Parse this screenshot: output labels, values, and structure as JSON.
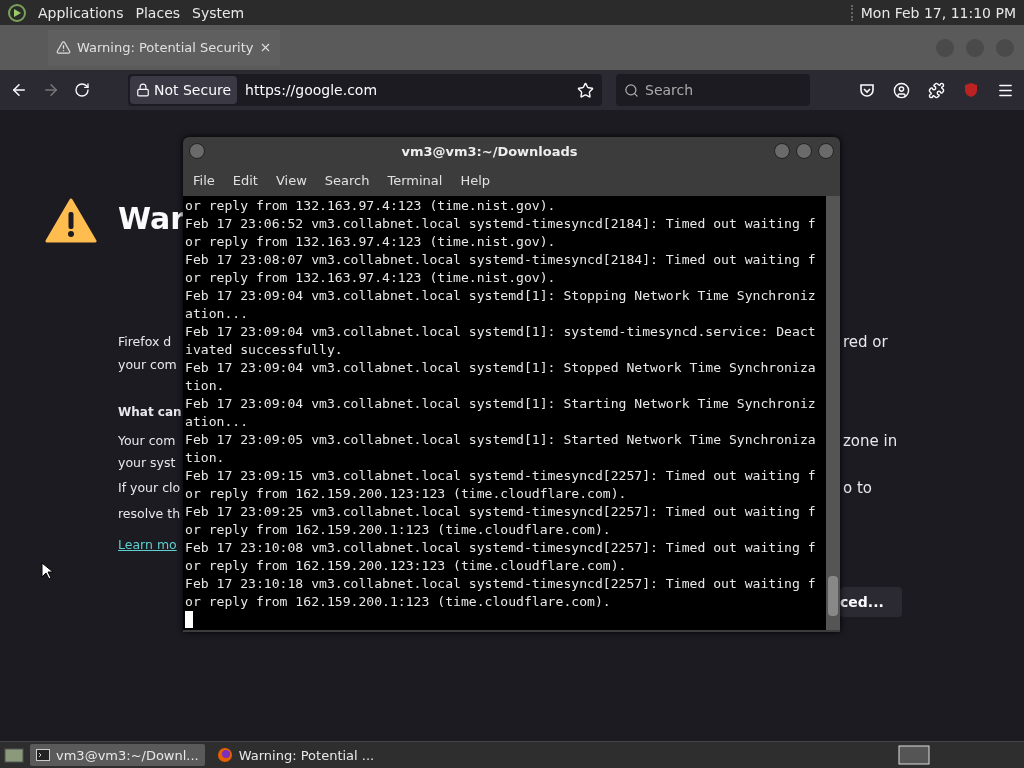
{
  "top_panel": {
    "menus": [
      "Applications",
      "Places",
      "System"
    ],
    "clock": "Mon Feb 17, 11:10 PM"
  },
  "browser": {
    "tabs": [
      {
        "title": "Warning: Potential Security",
        "selected": true
      }
    ],
    "url_bar": {
      "security_label": "Not Secure",
      "url": "https://google.com"
    },
    "search": {
      "placeholder": "Search"
    },
    "page": {
      "heading": "War",
      "rows": [
        {
          "kind": "text",
          "left": "Firefox d",
          "right": "red or"
        },
        {
          "kind": "text",
          "left": "your com"
        },
        {
          "kind": "subheading",
          "left": "What can"
        },
        {
          "kind": "text",
          "left": "Your com",
          "right": "zone in"
        },
        {
          "kind": "text",
          "left": "your syst"
        },
        {
          "kind": "text",
          "left": "If your clo",
          "right": "o to"
        },
        {
          "kind": "text",
          "left": "resolve th"
        },
        {
          "kind": "link",
          "left": "Learn mo"
        }
      ],
      "advanced_button": "ced..."
    }
  },
  "terminal": {
    "title": "vm3@vm3:~/Downloads",
    "menus": [
      "File",
      "Edit",
      "View",
      "Search",
      "Terminal",
      "Help"
    ],
    "lines": [
      "or reply from 132.163.97.4:123 (time.nist.gov).",
      "Feb 17 23:06:52 vm3.collabnet.local systemd-timesyncd[2184]: Timed out waiting f",
      "or reply from 132.163.97.4:123 (time.nist.gov).",
      "Feb 17 23:08:07 vm3.collabnet.local systemd-timesyncd[2184]: Timed out waiting f",
      "or reply from 132.163.97.4:123 (time.nist.gov).",
      "Feb 17 23:09:04 vm3.collabnet.local systemd[1]: Stopping Network Time Synchroniz",
      "ation...",
      "Feb 17 23:09:04 vm3.collabnet.local systemd[1]: systemd-timesyncd.service: Deact",
      "ivated successfully.",
      "Feb 17 23:09:04 vm3.collabnet.local systemd[1]: Stopped Network Time Synchroniza",
      "tion.",
      "Feb 17 23:09:04 vm3.collabnet.local systemd[1]: Starting Network Time Synchroniz",
      "ation...",
      "Feb 17 23:09:05 vm3.collabnet.local systemd[1]: Started Network Time Synchroniza",
      "tion.",
      "Feb 17 23:09:15 vm3.collabnet.local systemd-timesyncd[2257]: Timed out waiting f",
      "or reply from 162.159.200.123:123 (time.cloudflare.com).",
      "Feb 17 23:09:25 vm3.collabnet.local systemd-timesyncd[2257]: Timed out waiting f",
      "or reply from 162.159.200.1:123 (time.cloudflare.com).",
      "Feb 17 23:10:08 vm3.collabnet.local systemd-timesyncd[2257]: Timed out waiting f",
      "or reply from 162.159.200.123:123 (time.cloudflare.com).",
      "Feb 17 23:10:18 vm3.collabnet.local systemd-timesyncd[2257]: Timed out waiting f",
      "or reply from 162.159.200.1:123 (time.cloudflare.com)."
    ]
  },
  "taskbar": {
    "items": [
      {
        "label": "vm3@vm3:~/Downl...",
        "kind": "terminal",
        "selected": true
      },
      {
        "label": "Warning: Potential ...",
        "kind": "browser",
        "selected": false
      }
    ]
  }
}
